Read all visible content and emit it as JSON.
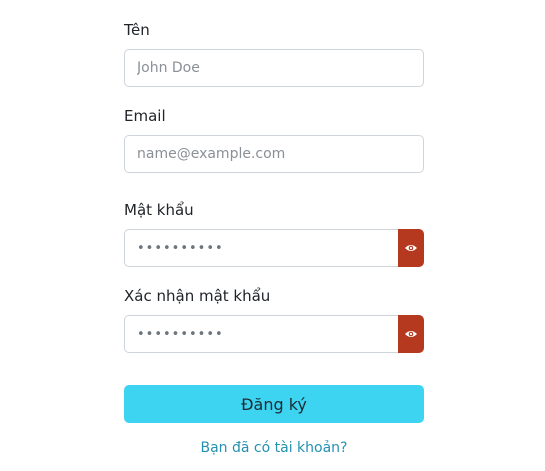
{
  "form": {
    "name": {
      "label": "Tên",
      "placeholder": "John Doe",
      "value": ""
    },
    "email": {
      "label": "Email",
      "placeholder": "name@example.com",
      "value": ""
    },
    "password": {
      "label": "Mật khẩu",
      "value": "••••••••••"
    },
    "confirm_password": {
      "label": "Xác nhận mật khẩu",
      "value": "••••••••••"
    },
    "submit_label": "Đăng ký",
    "login_link": "Bạn đã có tài khoản?"
  },
  "colors": {
    "submit_button": "#3dd4f2",
    "eye_button": "#b5391f",
    "link": "#2491b0"
  },
  "icons": {
    "toggle_password": "eye-icon"
  }
}
